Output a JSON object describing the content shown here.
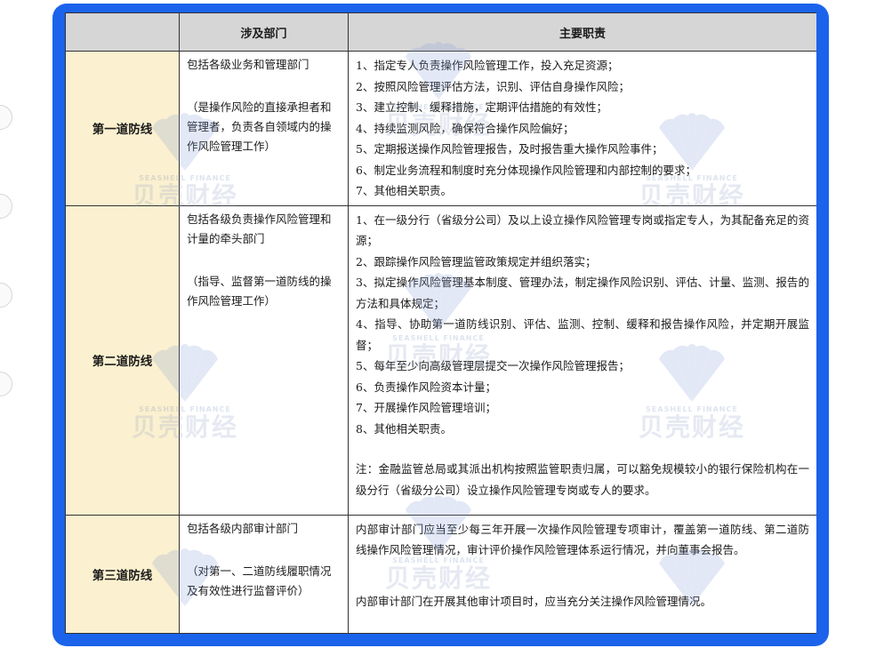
{
  "table": {
    "header": {
      "corner": "",
      "col_dept": "涉及部门",
      "col_duties": "主要职责"
    },
    "rows": [
      {
        "line": "第一道防线",
        "dept": "包括各级业务和管理部门",
        "dept_note": "（是操作风险的直接承担者和管理者，负责各自领域内的操作风险管理工作）",
        "duties": [
          "1、指定专人负责操作风险管理工作，投入充足资源；",
          "2、按照风险管理评估方法，识别、评估自身操作风险；",
          "3、建立控制、缓释措施，定期评估措施的有效性；",
          "4、持续监测风险，确保符合操作风险偏好；",
          "5、定期报送操作风险管理报告，及时报告重大操作风险事件；",
          "6、制定业务流程和制度时充分体现操作风险管理和内部控制的要求；",
          "7、其他相关职责。"
        ]
      },
      {
        "line": "第二道防线",
        "dept": "包括各级负责操作风险管理和计量的牵头部门",
        "dept_note": "（指导、监督第一道防线的操作风险管理工作）",
        "duties": [
          "1、在一级分行（省级分公司）及以上设立操作风险管理专岗或指定专人，为其配备充足的资源；",
          "2、跟踪操作风险管理监管政策规定并组织落实；",
          "3、拟定操作风险管理基本制度、管理办法，制定操作风险识别、评估、计量、监测、报告的方法和具体规定；",
          "4、指导、协助第一道防线识别、评估、监测、控制、缓释和报告操作风险，并定期开展监督；",
          "5、每年至少向高级管理层提交一次操作风险管理报告；",
          "6、负责操作风险资本计量；",
          "7、开展操作风险管理培训；",
          "8、其他相关职责。"
        ],
        "note": "注：金融监管总局或其派出机构按照监管职责归属，可以豁免规模较小的银行保险机构在一级分行（省级分公司）设立操作风险管理专岗或专人的要求。"
      },
      {
        "line": "第三道防线",
        "dept": "包括各级内部审计部门",
        "dept_note": "（对第一、二道防线履职情况及有效性进行监督评价）",
        "duties_para1": "内部审计部门应当至少每三年开展一次操作风险管理专项审计，覆盖第一道防线、第二道防线操作风险管理情况，审计评价操作风险管理体系运行情况，并向董事会报告。",
        "duties_para2": "内部审计部门在开展其他审计项目时，应当充分关注操作风险管理情况。"
      }
    ]
  },
  "watermark": {
    "brand_cn": "贝壳财经",
    "brand_en": "SEASHELL FINANCE",
    "icon": "seashell-logo"
  },
  "colors": {
    "frame": "#1b63ea",
    "header_bg": "#d6d6d6",
    "label_bg": "#fbf0cf"
  }
}
